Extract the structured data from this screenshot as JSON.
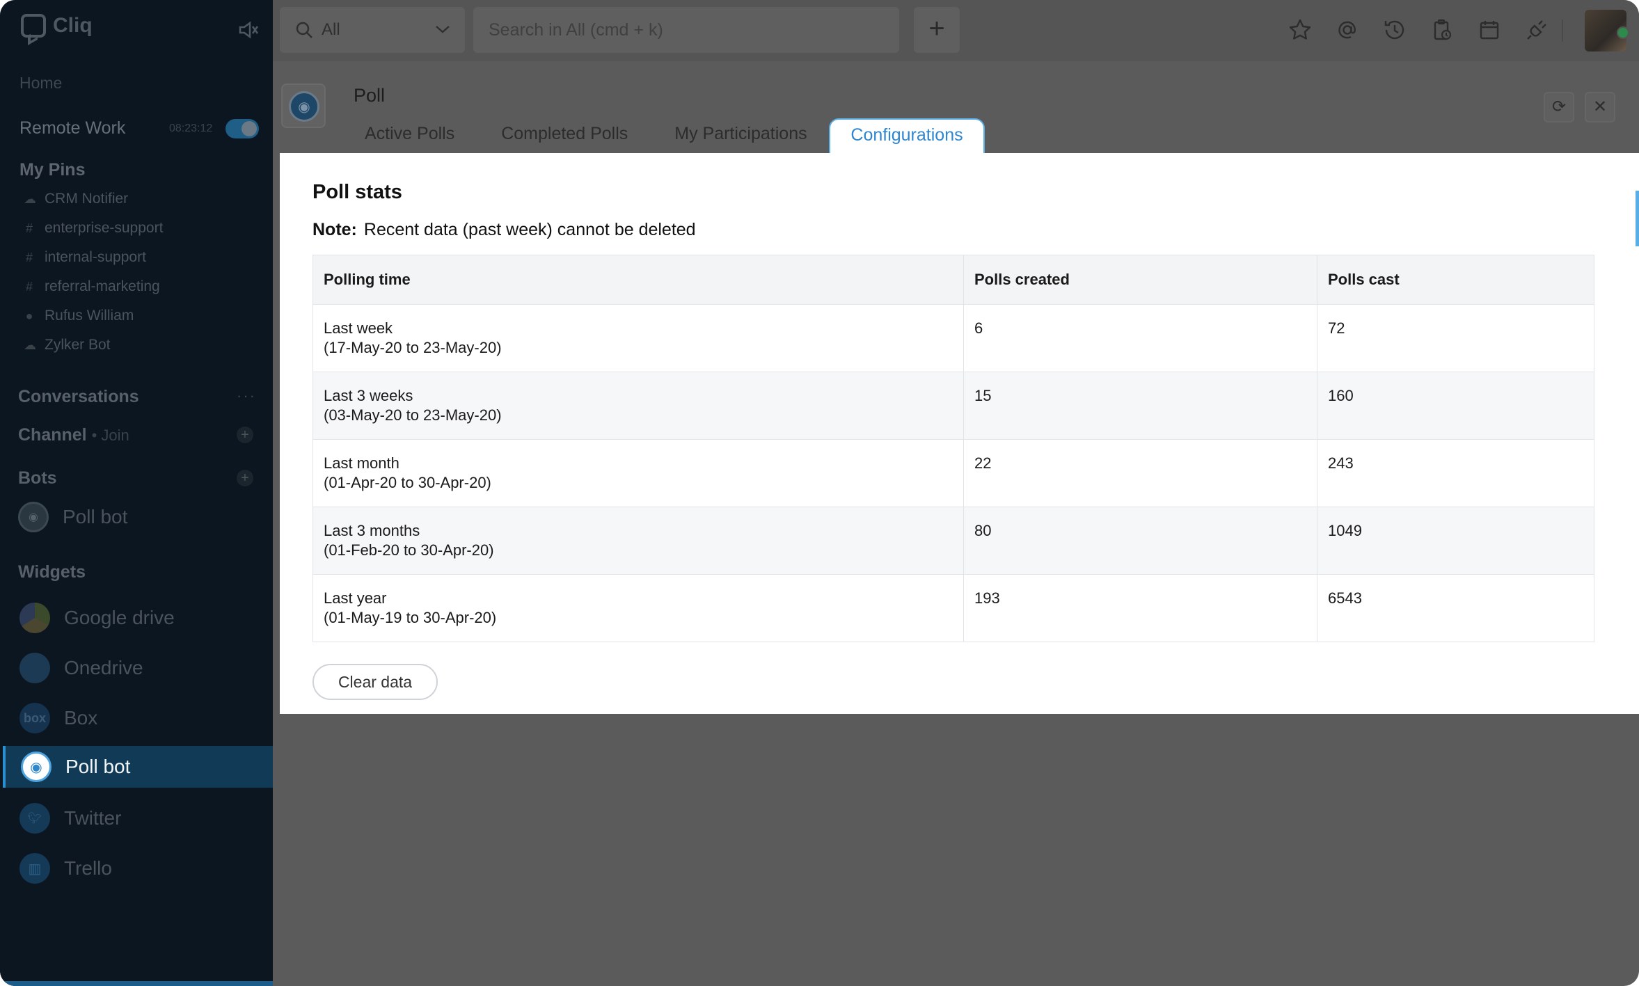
{
  "app": {
    "name": "Cliq"
  },
  "sidebar": {
    "home": "Home",
    "remote_work": {
      "label": "Remote Work",
      "time": "08:23:12"
    },
    "my_pins": {
      "title": "My Pins",
      "items": [
        {
          "icon": "cloud-icon",
          "label": "CRM Notifier"
        },
        {
          "icon": "hash-icon",
          "label": "enterprise-support"
        },
        {
          "icon": "hash-icon",
          "label": "internal-support"
        },
        {
          "icon": "hash-icon",
          "label": "referral-marketing"
        },
        {
          "icon": "user-status-icon",
          "label": "Rufus William"
        },
        {
          "icon": "cloud-icon",
          "label": "Zylker Bot"
        }
      ]
    },
    "conversations": "Conversations",
    "channel": {
      "label": "Channel",
      "join": "• Join"
    },
    "bots": {
      "label": "Bots",
      "items": [
        {
          "label": "Poll bot"
        }
      ]
    },
    "widgets": {
      "label": "Widgets",
      "items": [
        {
          "label": "Google drive",
          "icon": "google-drive-icon"
        },
        {
          "label": "Onedrive",
          "icon": "onedrive-icon"
        },
        {
          "label": "Box",
          "icon": "box-icon",
          "glyph": "box"
        },
        {
          "label": "Poll bot",
          "icon": "poll-bot-icon"
        },
        {
          "label": "Twitter",
          "icon": "twitter-icon"
        },
        {
          "label": "Trello",
          "icon": "trello-icon"
        }
      ]
    }
  },
  "topbar": {
    "scope": "All",
    "search_placeholder": "Search in All (cmd + k)",
    "icons": [
      "star-icon",
      "mention-icon",
      "history-icon",
      "reminder-icon",
      "calendar-icon",
      "integrations-icon"
    ]
  },
  "poll": {
    "title": "Poll",
    "tabs": [
      "Active Polls",
      "Completed Polls",
      "My Participations"
    ],
    "active_tab": "Configurations"
  },
  "stats": {
    "title": "Poll stats",
    "note_label": "Note:",
    "note_text": "Recent data (past week) cannot be deleted",
    "headers": [
      "Polling time",
      "Polls created",
      "Polls cast"
    ],
    "rows": [
      {
        "period": "Last week",
        "range": "(17-May-20 to 23-May-20)",
        "created": "6",
        "cast": "72"
      },
      {
        "period": "Last 3 weeks",
        "range": "(03-May-20 to 23-May-20)",
        "created": "15",
        "cast": "160"
      },
      {
        "period": "Last month",
        "range": "(01-Apr-20 to 30-Apr-20)",
        "created": "22",
        "cast": "243"
      },
      {
        "period": "Last 3 months",
        "range": "(01-Feb-20 to 30-Apr-20)",
        "created": "80",
        "cast": "1049"
      },
      {
        "period": "Last year",
        "range": "(01-May-19 to 30-Apr-20)",
        "created": "193",
        "cast": "6543"
      }
    ],
    "clear_button": "Clear data"
  }
}
